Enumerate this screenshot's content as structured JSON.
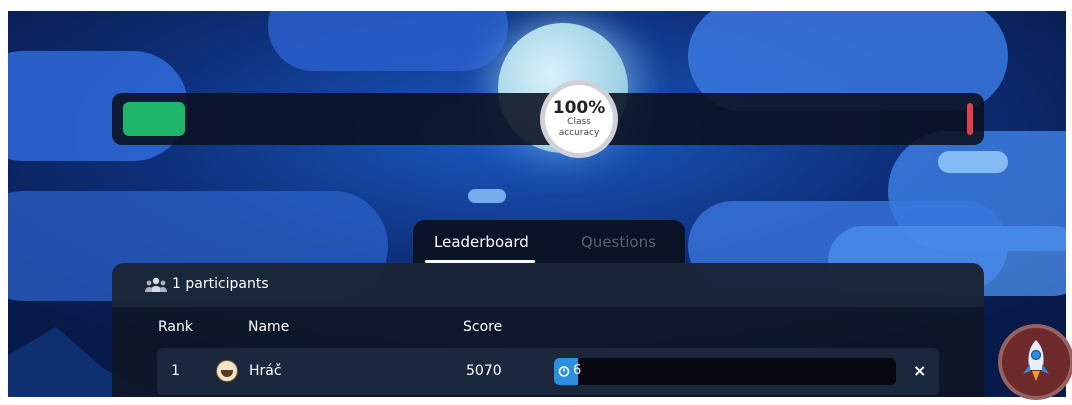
{
  "accuracy": {
    "value": "100%",
    "label": "Class accuracy",
    "correct_fraction": 0.07,
    "colors": {
      "correct": "#1fb56b",
      "incorrect": "#e0404d"
    }
  },
  "tabs": {
    "leaderboard": "Leaderboard",
    "questions": "Questions",
    "active": "Leaderboard"
  },
  "leaderboard": {
    "participants_label": "1 participants",
    "participants_icon": "people-icon",
    "columns": {
      "rank": "Rank",
      "name": "Name",
      "score": "Score"
    },
    "rows": [
      {
        "rank": "1",
        "name": "Hráč",
        "score": "5070",
        "streak": "6",
        "avatar_icon": "avatar-icon",
        "remove_label": "×"
      }
    ]
  },
  "fab": {
    "icon": "rocket-icon"
  },
  "colors": {
    "accent": "#2b8fe0",
    "panel": "#0e1626"
  }
}
